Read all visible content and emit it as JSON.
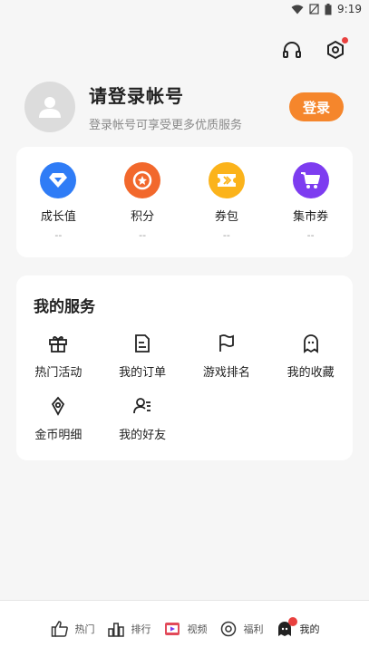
{
  "status_bar": {
    "time": "9:19"
  },
  "profile": {
    "title": "请登录帐号",
    "subtitle": "登录帐号可享受更多优质服务",
    "login_button": "登录"
  },
  "stats": [
    {
      "label": "成长值",
      "value": "--",
      "color": "#2f7cf6",
      "icon": "diamond-icon"
    },
    {
      "label": "积分",
      "value": "--",
      "color": "#f2682c",
      "icon": "points-badge-icon"
    },
    {
      "label": "券包",
      "value": "--",
      "color": "#fbb31b",
      "icon": "ticket-icon"
    },
    {
      "label": "集市券",
      "value": "--",
      "color": "#7d3cf0",
      "icon": "cart-icon"
    }
  ],
  "services": {
    "title": "我的服务",
    "items": [
      {
        "label": "热门活动",
        "icon": "gift-icon"
      },
      {
        "label": "我的订单",
        "icon": "order-icon"
      },
      {
        "label": "游戏排名",
        "icon": "flag-icon"
      },
      {
        "label": "我的收藏",
        "icon": "ghost-icon"
      },
      {
        "label": "金币明细",
        "icon": "coin-icon"
      },
      {
        "label": "我的好友",
        "icon": "friends-icon"
      }
    ]
  },
  "bottom_nav": [
    {
      "label": "热门",
      "icon": "thumbs-up-icon"
    },
    {
      "label": "排行",
      "icon": "ranking-icon"
    },
    {
      "label": "视频",
      "icon": "video-icon"
    },
    {
      "label": "福利",
      "icon": "welfare-icon"
    },
    {
      "label": "我的",
      "icon": "profile-icon",
      "active": true
    }
  ]
}
